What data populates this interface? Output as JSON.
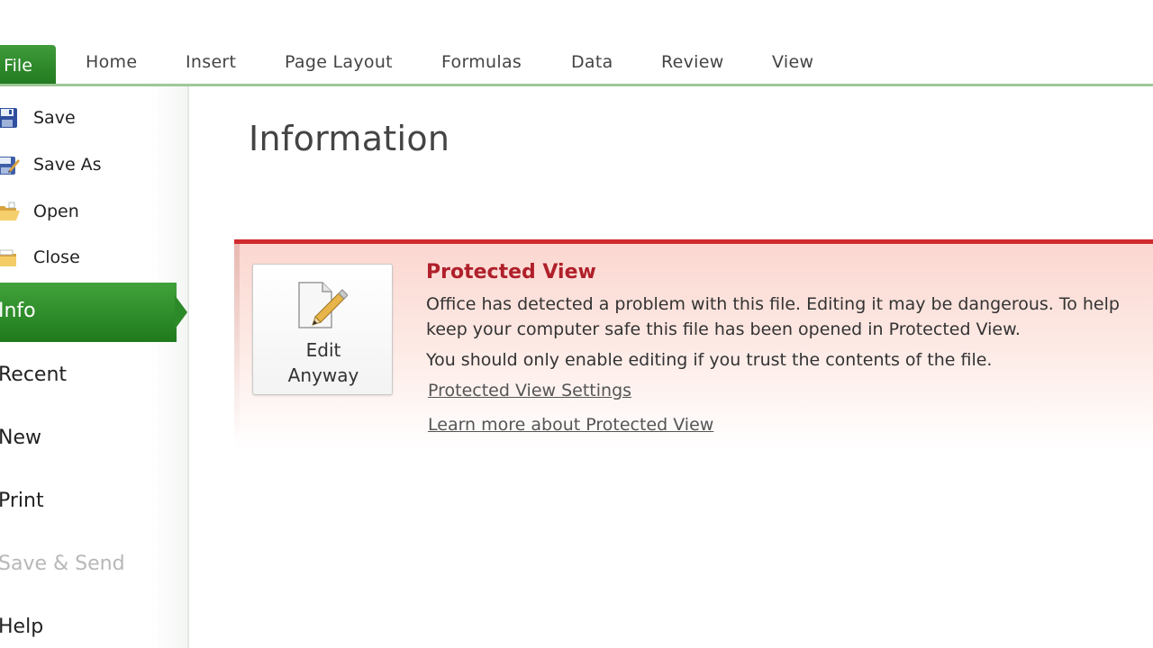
{
  "ribbon": {
    "file_tab": "File",
    "tabs": [
      "Home",
      "Insert",
      "Page Layout",
      "Formulas",
      "Data",
      "Review",
      "View"
    ]
  },
  "sidebar": {
    "commands": [
      {
        "label": "Save",
        "icon": "save-icon"
      },
      {
        "label": "Save As",
        "icon": "save-as-icon"
      },
      {
        "label": "Open",
        "icon": "open-folder-icon"
      },
      {
        "label": "Close",
        "icon": "close-folder-icon"
      }
    ],
    "nav": [
      {
        "label": "Info",
        "active": true
      },
      {
        "label": "Recent"
      },
      {
        "label": "New"
      },
      {
        "label": "Print"
      },
      {
        "label": "Save & Send",
        "disabled": true
      },
      {
        "label": "Help"
      }
    ]
  },
  "main": {
    "title": "Information",
    "protected_view": {
      "button_line1": "Edit",
      "button_line2": "Anyway",
      "heading": "Protected View",
      "line1": "Office has detected a problem with this file. Editing it may be dangerous. To help",
      "line2": "keep your computer safe this file has been opened in Protected View.",
      "line3": "You should only enable editing if you trust the contents of the file.",
      "link1": "Protected View Settings",
      "link2": "Learn more about Protected View"
    }
  },
  "colors": {
    "accent_green": "#217a1f",
    "warning_red": "#d02a2f",
    "warning_bg": "#fbd7d0"
  }
}
